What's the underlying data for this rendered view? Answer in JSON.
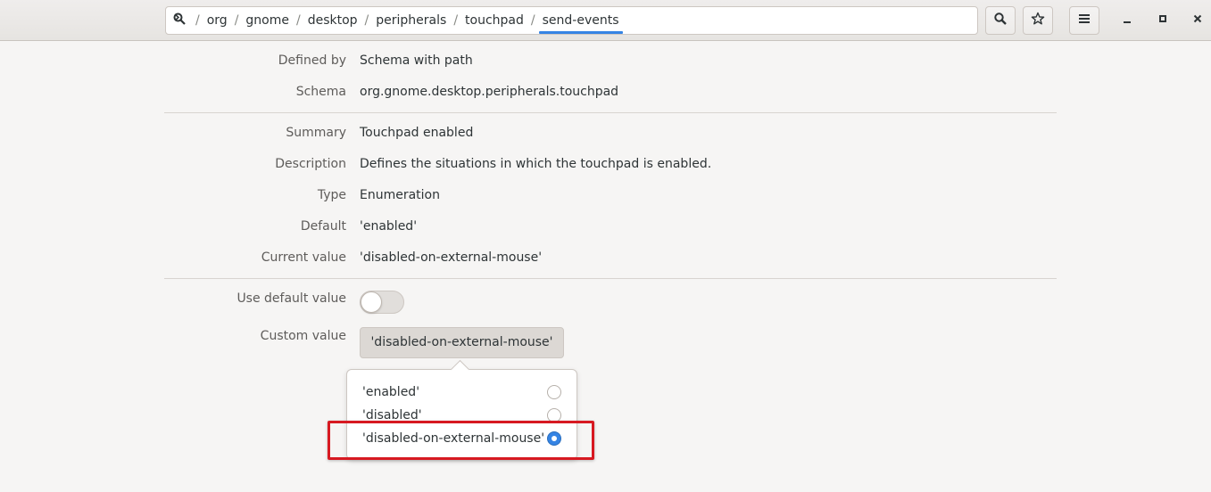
{
  "pathbar": {
    "root_icon": "search-root-icon",
    "crumbs": [
      "org",
      "gnome",
      "desktop",
      "peripherals",
      "touchpad",
      "send-events"
    ],
    "separator": "/"
  },
  "header_buttons": {
    "search_icon": "search-icon",
    "bookmark_icon": "star-icon",
    "menu_icon": "hamburger-menu-icon"
  },
  "window_controls": {
    "minimize_icon": "minimize-icon",
    "maximize_icon": "maximize-icon",
    "close_icon": "close-icon"
  },
  "details": {
    "defined_by": {
      "label": "Defined by",
      "value": "Schema with path"
    },
    "schema": {
      "label": "Schema",
      "value": "org.gnome.desktop.peripherals.touchpad"
    },
    "summary": {
      "label": "Summary",
      "value": "Touchpad enabled"
    },
    "description": {
      "label": "Description",
      "value": "Defines the situations in which the touchpad is enabled."
    },
    "type": {
      "label": "Type",
      "value": "Enumeration"
    },
    "default": {
      "label": "Default",
      "value": "'enabled'"
    },
    "current_value": {
      "label": "Current value",
      "value": "'disabled-on-external-mouse'"
    }
  },
  "use_default": {
    "label": "Use default value",
    "enabled": false
  },
  "custom_value": {
    "label": "Custom value",
    "selected": "'disabled-on-external-mouse'"
  },
  "options": [
    {
      "label": "'enabled'",
      "checked": false
    },
    {
      "label": "'disabled'",
      "checked": false
    },
    {
      "label": "'disabled-on-external-mouse'",
      "checked": true
    }
  ],
  "colors": {
    "accent": "#3584e4",
    "highlight_box": "#d71921"
  }
}
